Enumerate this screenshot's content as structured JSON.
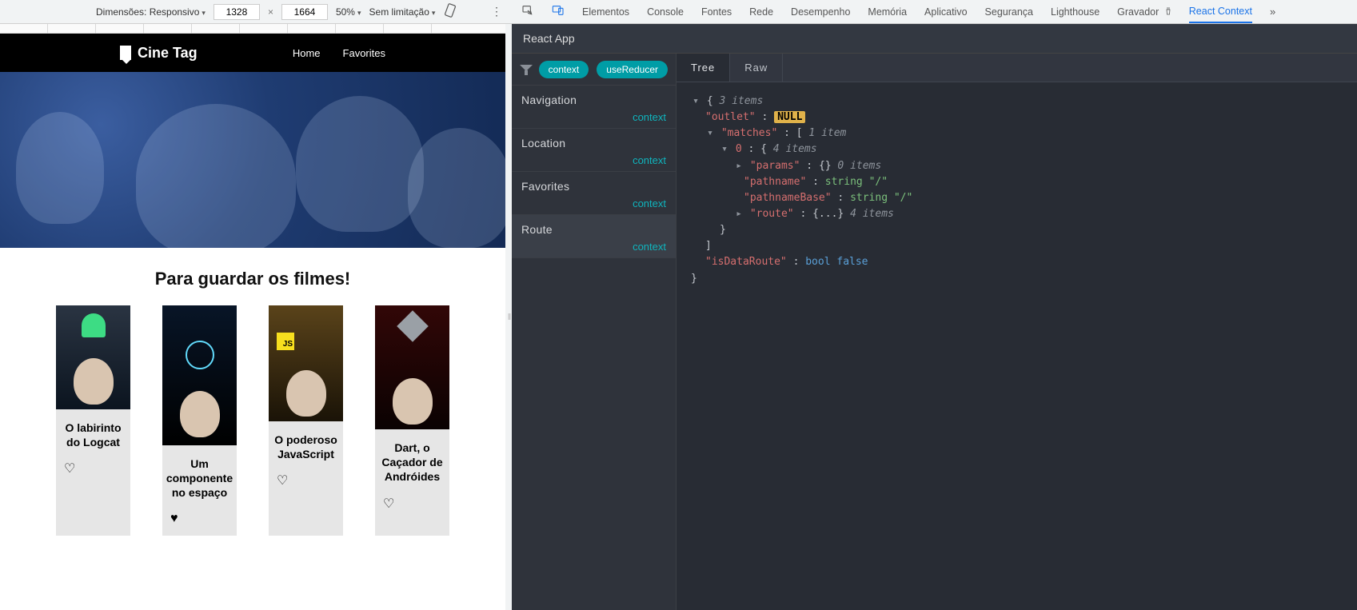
{
  "toolbar": {
    "dimensions_label": "Dimensões: Responsivo",
    "width_value": "1328",
    "height_value": "1664",
    "zoom": "50%",
    "throttle": "Sem limitação"
  },
  "devtabs": {
    "items": [
      "Elementos",
      "Console",
      "Fontes",
      "Rede",
      "Desempenho",
      "Memória",
      "Aplicativo",
      "Segurança",
      "Lighthouse",
      "Gravador",
      "React Context"
    ],
    "active": "React Context"
  },
  "app": {
    "logo_text": "Cine Tag",
    "nav": {
      "home": "Home",
      "favorites": "Favorites"
    },
    "page_title": "Para guardar os filmes!",
    "cards": [
      {
        "title": "O labirinto do Logcat",
        "liked": false
      },
      {
        "title": "Um componente no espaço",
        "liked": true
      },
      {
        "title": "O poderoso JavaScript",
        "liked": false
      },
      {
        "title": "Dart, o Caçador de Andróides",
        "liked": false
      }
    ]
  },
  "react_context": {
    "header_title": "React App",
    "pills": {
      "context": "context",
      "useReducer": "useReducer"
    },
    "items": [
      {
        "name": "Navigation",
        "sub": "context"
      },
      {
        "name": "Location",
        "sub": "context"
      },
      {
        "name": "Favorites",
        "sub": "context"
      },
      {
        "name": "Route",
        "sub": "context"
      }
    ],
    "selected_index": 3,
    "tabs": {
      "tree": "Tree",
      "raw": "Raw",
      "active": "Tree"
    },
    "tree": {
      "rootCount": "3 items",
      "outletKey": "\"outlet\"",
      "nullWord": "NULL",
      "matchesKey": "\"matches\"",
      "matchesCount": "1 item",
      "idx0Key": "0",
      "idx0Count": "4 items",
      "paramsKey": "\"params\"",
      "paramsCount": "0 items",
      "pathnameKey": "\"pathname\"",
      "pathnameType": "string",
      "pathnameVal": "\"/\"",
      "pathnameBaseKey": "\"pathnameBase\"",
      "pathnameBaseType": "string",
      "pathnameBaseVal": "\"/\"",
      "routeKey": "\"route\"",
      "routeCount": "4 items",
      "isDataRouteKey": "\"isDataRoute\"",
      "isDataRouteType": "bool",
      "isDataRouteVal": "false"
    }
  }
}
